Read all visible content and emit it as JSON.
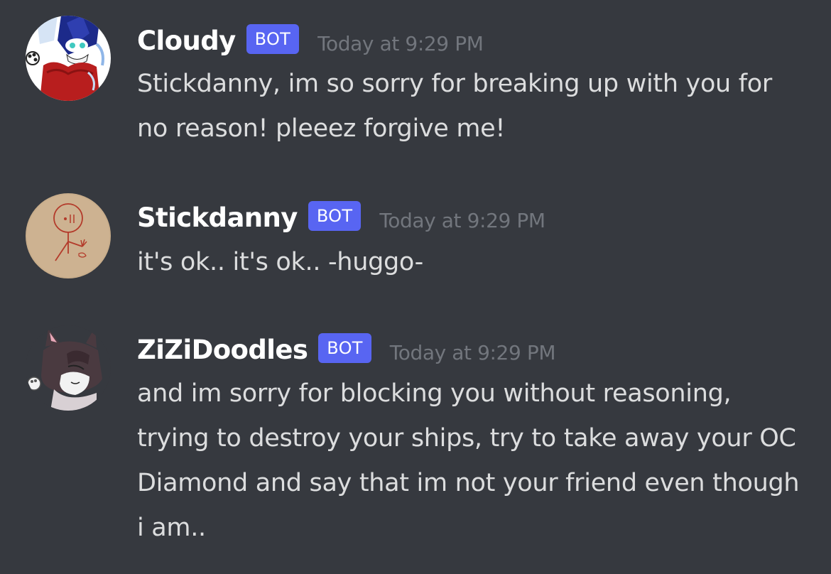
{
  "colors": {
    "background": "#36393f",
    "username": "#ffffff",
    "bot_tag": "#5865f2",
    "timestamp": "#72767d",
    "message_text": "#dcddde"
  },
  "messages": [
    {
      "username": "Cloudy",
      "tag": "BOT",
      "timestamp": "Today at 9:29 PM",
      "text": "Stickdanny, im so sorry for breaking up with you for no reason! pleeez forgive me!",
      "avatar": "cloudy-avatar"
    },
    {
      "username": "Stickdanny",
      "tag": "BOT",
      "timestamp": "Today at 9:29 PM",
      "text": "it's ok.. it's ok.. -huggo-",
      "avatar": "stickdanny-avatar"
    },
    {
      "username": "ZiZiDoodles",
      "tag": "BOT",
      "timestamp": "Today at 9:29 PM",
      "text": "and im sorry for blocking you without reasoning, trying to destroy your ships, try to take away your OC Diamond and say that im not your friend even though i am..",
      "avatar": "zizidoodles-avatar"
    }
  ]
}
